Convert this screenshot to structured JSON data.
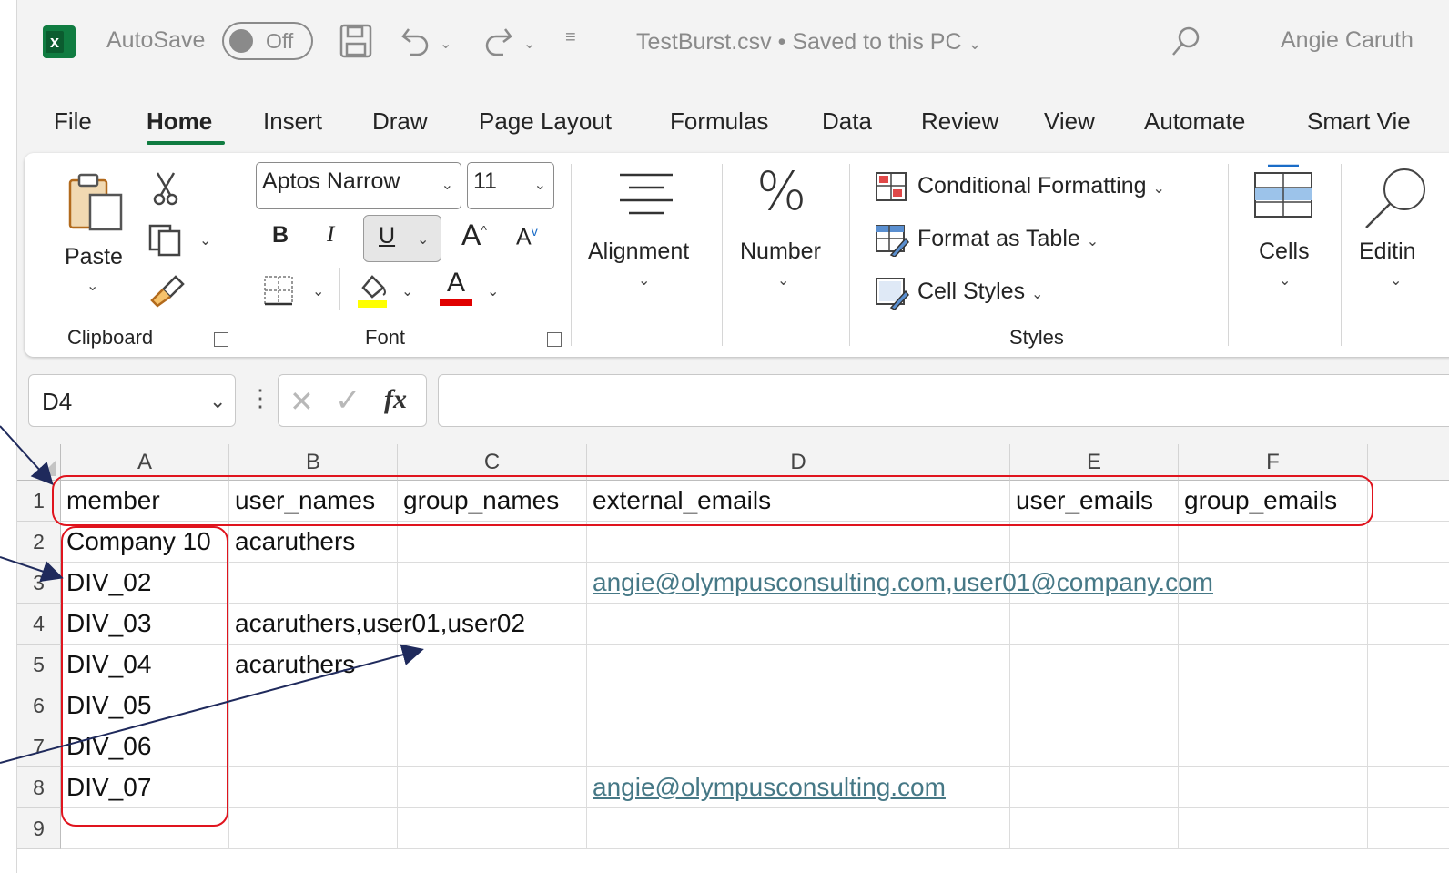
{
  "title_bar": {
    "autosave_label": "AutoSave",
    "autosave_state": "Off",
    "file_name": "TestBurst.csv",
    "save_status": "Saved to this PC",
    "user_name": "Angie Caruth"
  },
  "tabs": [
    "File",
    "Home",
    "Insert",
    "Draw",
    "Page Layout",
    "Formulas",
    "Data",
    "Review",
    "View",
    "Automate",
    "Smart Vie"
  ],
  "ribbon": {
    "clipboard": {
      "paste_label": "Paste",
      "group_label": "Clipboard"
    },
    "font": {
      "font_name": "Aptos Narrow",
      "font_size": "11",
      "bold": "B",
      "italic": "I",
      "underline": "U",
      "grow_font": "A",
      "shrink_font": "A",
      "font_color_glyph": "A",
      "group_label": "Font",
      "highlight_color": "#ffff00",
      "font_color": "#e00000"
    },
    "alignment_label": "Alignment",
    "number": {
      "symbol": "%",
      "label": "Number"
    },
    "styles": {
      "conditional_formatting": "Conditional Formatting",
      "format_as_table": "Format as Table",
      "cell_styles": "Cell Styles",
      "group_label": "Styles"
    },
    "cells_label": "Cells",
    "editing_label": "Editin"
  },
  "formula_bar": {
    "name_box": "D4",
    "fx_label": "fx",
    "formula": ""
  },
  "sheet": {
    "columns": [
      "A",
      "B",
      "C",
      "D",
      "E",
      "F"
    ],
    "rows": [
      {
        "num": "1",
        "cells": [
          "member",
          "user_names",
          "group_names",
          "external_emails",
          "user_emails",
          "group_emails"
        ]
      },
      {
        "num": "2",
        "cells": [
          "Company 10",
          "acaruthers",
          "",
          "",
          "",
          ""
        ]
      },
      {
        "num": "3",
        "cells": [
          "DIV_02",
          "",
          "",
          "angie@olympusconsulting.com,user01@company.com",
          "",
          ""
        ]
      },
      {
        "num": "4",
        "cells": [
          "DIV_03",
          "acaruthers,user01,user02",
          "",
          "",
          "",
          ""
        ]
      },
      {
        "num": "5",
        "cells": [
          "DIV_04",
          "acaruthers",
          "",
          "",
          "",
          ""
        ]
      },
      {
        "num": "6",
        "cells": [
          "DIV_05",
          "",
          "",
          "",
          "",
          ""
        ]
      },
      {
        "num": "7",
        "cells": [
          "DIV_06",
          "",
          "",
          "",
          "",
          ""
        ]
      },
      {
        "num": "8",
        "cells": [
          "DIV_07",
          "",
          "",
          "angie@olympusconsulting.com",
          "",
          ""
        ]
      },
      {
        "num": "9",
        "cells": [
          "",
          "",
          "",
          "",
          "",
          ""
        ]
      }
    ],
    "link_color": "#467886"
  },
  "annotations": {
    "highlight_color": "#e0141e",
    "arrow_color": "#1f2a5c"
  }
}
